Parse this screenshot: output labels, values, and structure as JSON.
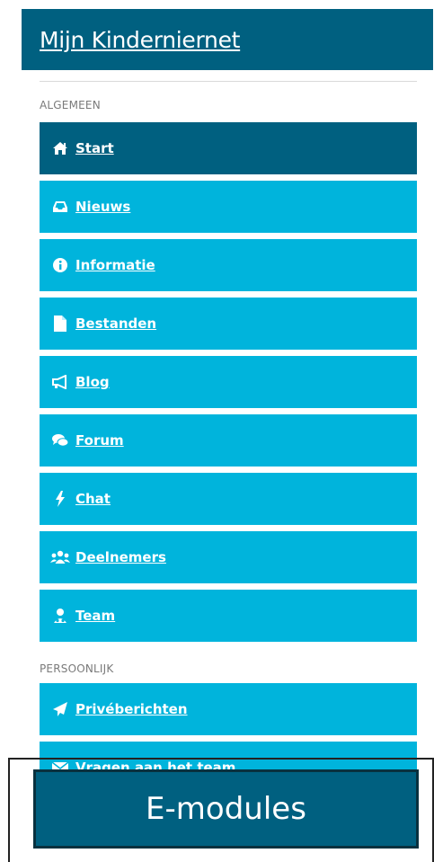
{
  "header": {
    "title": "Mijn Kinderniernet"
  },
  "sections": {
    "algemeen": "ALGEMEEN",
    "persoonlijk": "PERSOONLIJK"
  },
  "menu_algemeen": [
    {
      "label": "Start",
      "icon": "home-icon",
      "active": true
    },
    {
      "label": "Nieuws",
      "icon": "inbox-icon"
    },
    {
      "label": "Informatie",
      "icon": "info-icon"
    },
    {
      "label": "Bestanden",
      "icon": "file-icon"
    },
    {
      "label": "Blog",
      "icon": "megaphone-icon"
    },
    {
      "label": "Forum",
      "icon": "comments-icon"
    },
    {
      "label": "Chat",
      "icon": "bolt-icon"
    },
    {
      "label": "Deelnemers",
      "icon": "users-icon"
    },
    {
      "label": "Team",
      "icon": "user-team-icon"
    }
  ],
  "menu_persoonlijk": [
    {
      "label": "Privéberichten",
      "icon": "send-icon"
    },
    {
      "label": "Vragen aan het team",
      "icon": "envelope-icon"
    }
  ],
  "overlay": {
    "button_label": "E-modules"
  },
  "colors": {
    "header": "#006080",
    "item": "#00b4dc",
    "active_item": "#006080"
  }
}
